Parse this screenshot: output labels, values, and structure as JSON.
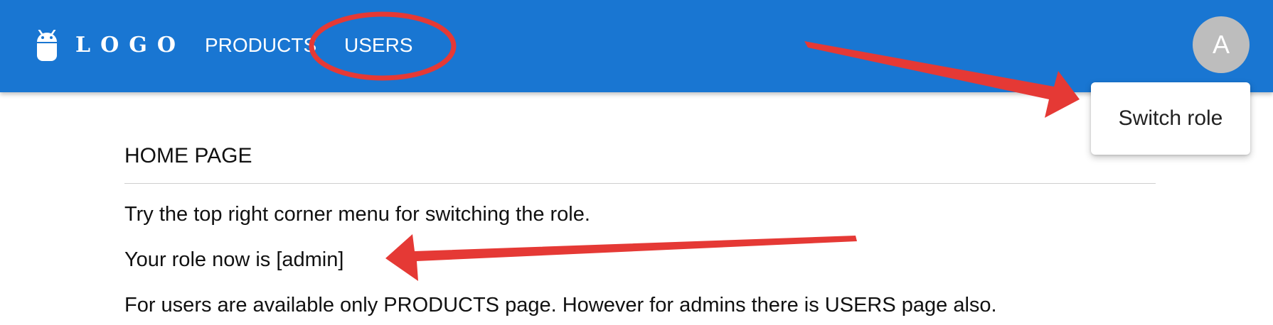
{
  "colors": {
    "appbar": "#1976d2",
    "avatar": "#bdbdbd",
    "annotation": "#e53935"
  },
  "header": {
    "logo_icon": "android-icon",
    "logo_text": "LOGO",
    "nav": [
      {
        "label": "PRODUCTS"
      },
      {
        "label": "USERS"
      }
    ],
    "avatar_initial": "A"
  },
  "menu": {
    "items": [
      {
        "label": "Switch role"
      }
    ]
  },
  "main": {
    "title": "HOME PAGE",
    "paragraphs": [
      "Try the top right corner menu for switching the role.",
      "Your role now is [admin]",
      "For users are available only PRODUCTS page. However for admins there is USERS page also."
    ]
  }
}
